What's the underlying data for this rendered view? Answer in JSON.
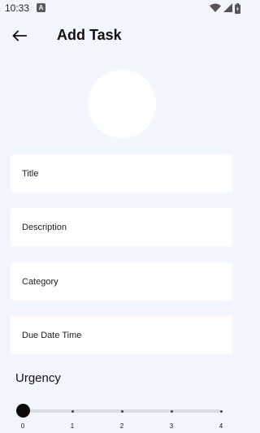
{
  "status_bar": {
    "time": "10:33",
    "notification_icon": "a-badge-icon",
    "icons": [
      "wifi-icon",
      "signal-icon",
      "battery-icon"
    ]
  },
  "app_bar": {
    "back_icon": "arrow-left-icon",
    "title": "Add Task"
  },
  "form": {
    "title_placeholder": "Title",
    "description_placeholder": "Description",
    "category_placeholder": "Category",
    "due_date_placeholder": "Due Date Time"
  },
  "urgency": {
    "label": "Urgency",
    "value": 0,
    "min": 0,
    "max": 4,
    "ticks": [
      "0",
      "1",
      "2",
      "3",
      "4"
    ]
  },
  "colors": {
    "background": "#f3f6fe",
    "field_background": "#ffffff",
    "slider_thumb": "#0a0a0a",
    "slider_track": "#d9dce3"
  }
}
